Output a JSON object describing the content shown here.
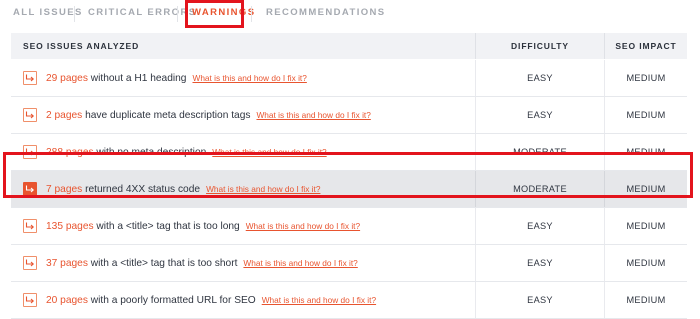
{
  "tabs": [
    {
      "label": "ALL ISSUES",
      "active": false
    },
    {
      "label": "CRITICAL ERRORS",
      "active": false
    },
    {
      "label": "WARNINGS",
      "active": true
    },
    {
      "label": "RECOMMENDATIONS",
      "active": false
    }
  ],
  "table": {
    "headers": {
      "issues": "SEO ISSUES ANALYZED",
      "difficulty": "DIFFICULTY",
      "impact": "SEO IMPACT"
    },
    "link_text": "What is this and how do I fix it?",
    "rows": [
      {
        "count": "29 pages",
        "text": " without a H1 heading",
        "difficulty": "EASY",
        "impact": "MEDIUM",
        "highlight": false
      },
      {
        "count": "2 pages",
        "text": " have duplicate meta description tags",
        "difficulty": "EASY",
        "impact": "MEDIUM",
        "highlight": false
      },
      {
        "count": "288 pages",
        "text": " with no meta description",
        "difficulty": "MODERATE",
        "impact": "MEDIUM",
        "highlight": false
      },
      {
        "count": "7 pages",
        "text": " returned 4XX status code",
        "difficulty": "MODERATE",
        "impact": "MEDIUM",
        "highlight": true
      },
      {
        "count": "135 pages",
        "text": " with a <title> tag that is too long",
        "difficulty": "EASY",
        "impact": "MEDIUM",
        "highlight": false
      },
      {
        "count": "37 pages",
        "text": " with a <title> tag that is too short",
        "difficulty": "EASY",
        "impact": "MEDIUM",
        "highlight": false
      },
      {
        "count": "20 pages",
        "text": " with a poorly formatted URL for SEO",
        "difficulty": "EASY",
        "impact": "MEDIUM",
        "highlight": false
      }
    ]
  },
  "colors": {
    "accent": "#e8542f",
    "annotation": "#e3141d",
    "highlight_row": "#e6e7ea",
    "header_bg": "#f1f2f5"
  },
  "icons": {
    "row_icon": "export-arrow-icon"
  }
}
